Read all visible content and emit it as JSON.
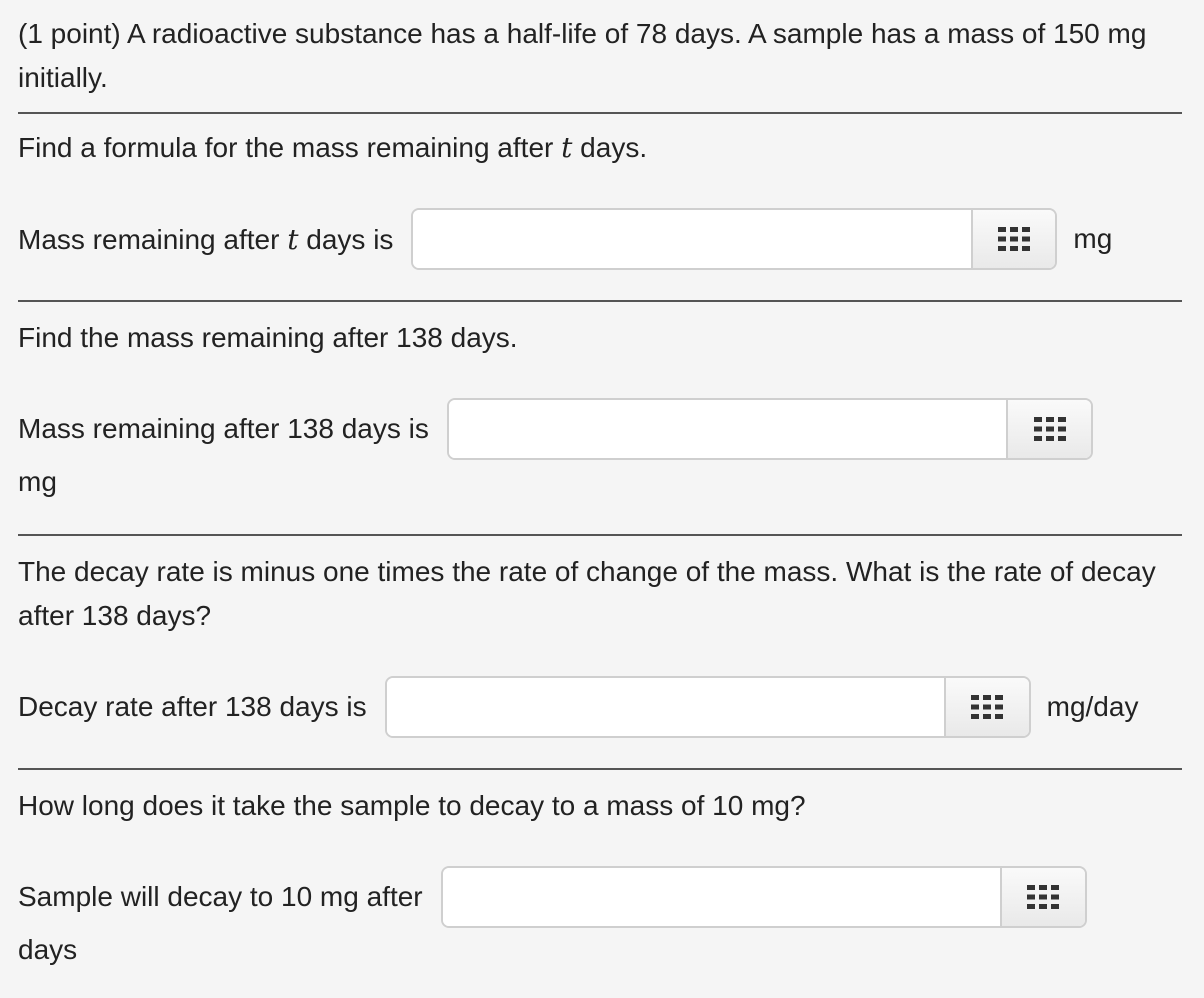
{
  "intro": "(1 point) A radioactive substance has a half-life of 78 days. A sample has a mass of 150 mg initially.",
  "parts": [
    {
      "question_before_var": "Find a formula for the mass remaining after ",
      "question_var": "t",
      "question_after_var": " days.",
      "label_before_var": "Mass remaining after ",
      "label_var": "t",
      "label_after_var": " days is",
      "input_value": "",
      "palette_icon": "grid-icon",
      "unit": "mg"
    },
    {
      "question": "Find the mass remaining after 138 days.",
      "label": "Mass remaining after 138 days is",
      "input_value": "",
      "palette_icon": "grid-icon",
      "unit": "mg"
    },
    {
      "question": "The decay rate is minus one times the rate of change of the mass. What is the rate of decay after 138 days?",
      "label": "Decay rate after 138 days is",
      "input_value": "",
      "palette_icon": "grid-icon",
      "unit": "mg/day"
    },
    {
      "question": "How long does it take the sample to decay to a mass of 10 mg?",
      "label": "Sample will decay to 10 mg after",
      "input_value": "",
      "palette_icon": "grid-icon",
      "unit": "days"
    }
  ]
}
